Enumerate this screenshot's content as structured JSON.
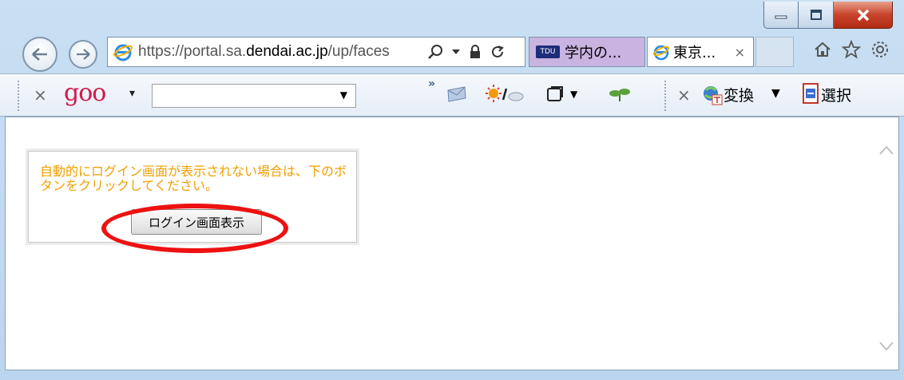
{
  "window": {
    "caption_buttons": [
      "minimize",
      "maximize",
      "close"
    ]
  },
  "address_bar": {
    "url_scheme": "https://",
    "url_host": "portal.sa.",
    "url_domain": "dendai.ac.jp",
    "url_path": "/up/faces",
    "search_icon": "search-icon",
    "dropdown_icon": "chevron-down-icon",
    "lock_icon": "lock-icon",
    "refresh_icon": "refresh-icon"
  },
  "tabs": [
    {
      "badge": "TDU",
      "label": "学内の...",
      "active": false
    },
    {
      "label": "東京...",
      "close": "×",
      "active": true
    }
  ],
  "toolbar_right_icons": [
    "home-icon",
    "star-icon",
    "gear-icon"
  ],
  "command_bar": {
    "close_goo": "×",
    "goo_logo": "goo",
    "goo_caret": "▾",
    "chevron": "»",
    "close_translate": "×",
    "translate_label": "変換",
    "translate_caret": "▼",
    "select_label": "選択"
  },
  "content": {
    "notice_text": "自動的にログイン画面が表示されない場合は、下のボタンをクリックしてください。",
    "login_button_label": "ログイン画面表示",
    "highlight_color": "#ee1111",
    "notice_color": "#f0a000"
  }
}
